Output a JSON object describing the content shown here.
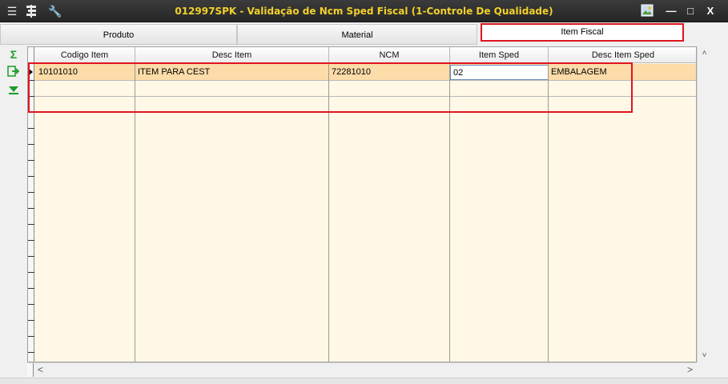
{
  "window": {
    "title": "012997SPK - Validação de Ncm Sped Fiscal (1-Controle De Qualidade)",
    "icons": [
      "menu-icon",
      "tree-icon",
      "wrench-icon"
    ],
    "image_icon": "picture-icon",
    "minimize": "—",
    "maximize": "□",
    "close": "X",
    "title_color": "#f2d02b"
  },
  "tabs": [
    {
      "label": "Produto",
      "active": false
    },
    {
      "label": "Material",
      "active": false
    },
    {
      "label": "Item Fiscal",
      "active": true
    }
  ],
  "toolbar": {
    "sum_icon": "Σ",
    "export_icon": "⇨",
    "down_icon": "▼"
  },
  "grid": {
    "columns": [
      "Codigo Item",
      "Desc Item",
      "NCM",
      "Item Sped",
      "Desc Item Sped"
    ],
    "rows": [
      {
        "codigo_item": "10101010",
        "desc_item": "ITEM PARA CEST",
        "ncm": "72281010",
        "item_sped": "02",
        "desc_item_sped": "EMBALAGEM"
      }
    ],
    "selected_color": "#fcdca8",
    "background_color": "#fff8e6"
  },
  "scrollbar": {
    "up": "˄",
    "down": "˅",
    "left": "<",
    "right": ">"
  },
  "accent": "#e0141e"
}
